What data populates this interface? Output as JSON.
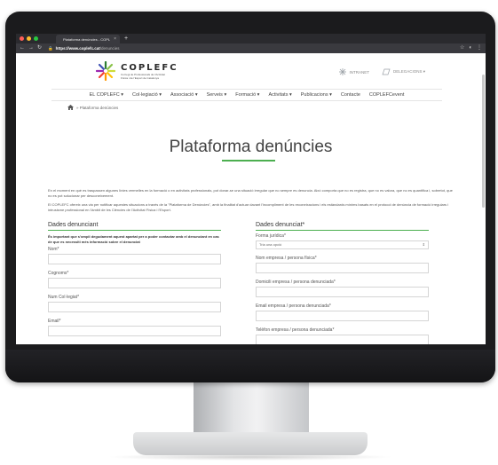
{
  "browser": {
    "tab_title": "Plataforma denúncies - COPL",
    "tab_close": "×",
    "new_tab": "+",
    "url_host": "https://www.coplefc.cat",
    "url_path": "/denuncies",
    "lock_icon": "lock-icon",
    "traffic_colors": [
      "#ff5f57",
      "#febc2e",
      "#28c840"
    ]
  },
  "site": {
    "logo_name": "COPLEFC",
    "logo_sub_1": "Col·legi de Professionals de l'Activitat",
    "logo_sub_2": "Física i de l'Esport de Catalunya",
    "intranet": "INTRANET",
    "delegacions": "DELEGACIONS ▾",
    "menu": [
      "EL COPLEFC ▾",
      "Col·legiació ▾",
      "Associació ▾",
      "Serveis ▾",
      "Formació ▾",
      "Activitats ▾",
      "Publicacions ▾",
      "Contacte",
      "COPLEFCevent"
    ],
    "breadcrumb_current": "» Plataforma denúncies",
    "accent_color": "#4caf50"
  },
  "page": {
    "title": "Plataforma denúncies",
    "intro_1": "En el moment en què es traspassen algunes línies vermelles en la formació o en activitats professionals, pot donar-se una situació irregular que no sempre es denuncia. Això comporta que no es registra, que no es valora, que no es quantifica i, sobretot, que no es pot solucionar per desconeixement.",
    "intro_2": "El COPLEFC ofereix una via per notificar aquestes situacions a través de la \"Plataforma de Denúncies\", amb la finalitat d'actuar davant l'incompliment de les reconeixacions i els estàndards mínims basats en el protocol de denúncia de formació irregulars i intrusisme professional en l'àmbit de les Ciències de l'Activitat Física i l'Esport."
  },
  "form": {
    "left_heading": "Dades denunciant",
    "left_note": "És important que s'ompli degudament aquest apartat per a poder contactar amb el denunciant en cas de que es necessiti més informació sobre el denunciat",
    "left_fields": [
      "Nom*",
      "Cognoms*",
      "Num Col·legiat*",
      "Email*"
    ],
    "right_heading": "Dades denunciat*",
    "forma_label": "Forma jurídica*",
    "forma_selected": "Tria una opció",
    "right_fields": [
      "Nom empresa / persona física*",
      "Domicili empresa / persona denunciada*",
      "Email empresa / persona denunciada*",
      "Telèfon empresa / persona denunciada*"
    ]
  }
}
